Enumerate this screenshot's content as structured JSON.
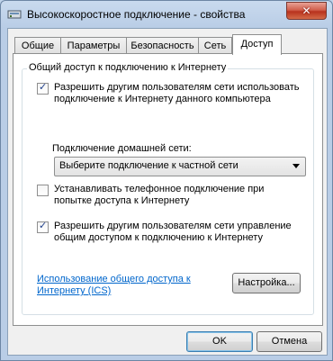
{
  "window": {
    "title": "Высокоскоростное подключение - свойства",
    "close_glyph": "✕"
  },
  "tabs": [
    {
      "label": "Общие"
    },
    {
      "label": "Параметры"
    },
    {
      "label": "Безопасность"
    },
    {
      "label": "Сеть"
    },
    {
      "label": "Доступ",
      "active": true
    }
  ],
  "sharing": {
    "group_label": "Общий доступ к подключению к Интернету",
    "allow_sharing": {
      "label": "Разрешить другим пользователям сети использовать подключение к Интернету данного компьютера",
      "checked": true
    },
    "home_network_label": "Подключение домашней сети:",
    "home_network_select": {
      "value": "Выберите подключение к частной сети"
    },
    "dial_on_demand": {
      "label": "Устанавливать телефонное подключение при попытке доступа к Интернету",
      "checked": false
    },
    "allow_control": {
      "label": "Разрешить другим пользователям сети управление общим доступом к подключению к Интернету",
      "checked": true
    },
    "ics_link": "Использование общего доступа к Интернету (ICS)",
    "settings_button": "Настройка..."
  },
  "footer": {
    "ok": "OK",
    "cancel": "Отмена"
  }
}
